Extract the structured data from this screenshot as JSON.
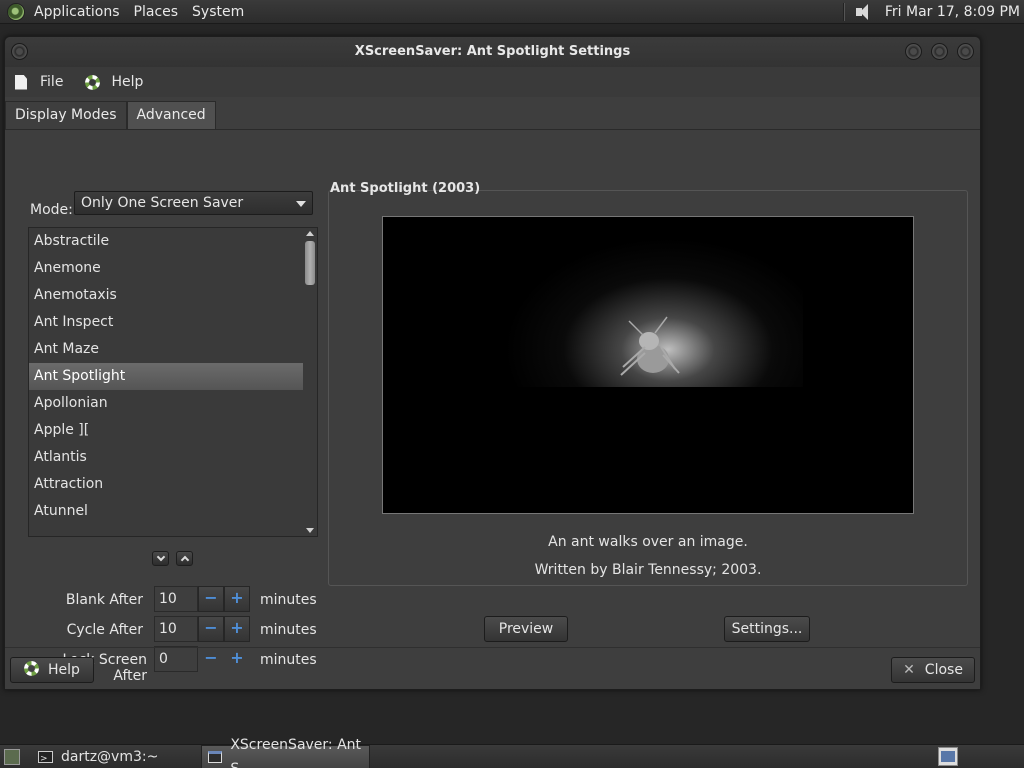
{
  "top_panel": {
    "menus": [
      "Applications",
      "Places",
      "System"
    ],
    "clock": "Fri Mar 17,  8:09 PM"
  },
  "window": {
    "title": "XScreenSaver: Ant Spotlight Settings",
    "menubar": {
      "file": "File",
      "help": "Help"
    },
    "tabs": [
      {
        "label": "Display Modes",
        "active": true
      },
      {
        "label": "Advanced",
        "active": false
      }
    ],
    "mode": {
      "label": "Mode:",
      "value": "Only One Screen Saver"
    },
    "list": {
      "items": [
        "Abstractile",
        "Anemone",
        "Anemotaxis",
        "Ant Inspect",
        "Ant Maze",
        "Ant Spotlight",
        "Apollonian",
        "Apple ][",
        "Atlantis",
        "Attraction",
        "Atunnel"
      ],
      "selected": "Ant Spotlight"
    },
    "timers": {
      "blank_after": {
        "label": "Blank After",
        "value": "10",
        "unit": "minutes"
      },
      "cycle_after": {
        "label": "Cycle After",
        "value": "10",
        "unit": "minutes"
      },
      "lock_after": {
        "label": "Lock Screen After",
        "value": "0",
        "unit": "minutes"
      },
      "minus": "−",
      "plus": "+"
    },
    "saver": {
      "title": "Ant Spotlight (2003)",
      "description": "An ant walks over an image.",
      "credit": "Written by Blair Tennessy; 2003."
    },
    "buttons": {
      "preview": "Preview",
      "settings": "Settings...",
      "help": "Help",
      "close": "Close"
    }
  },
  "taskbar": {
    "tasks": [
      {
        "label": "dartz@vm3:~",
        "active": false
      },
      {
        "label": "XScreenSaver: Ant S...",
        "active": true
      }
    ]
  },
  "colors": {
    "panel_bg": "#333333",
    "window_bg": "#3e3e3e",
    "selection": "#5e5e5e",
    "spin_accent": "#4f8fd8"
  }
}
